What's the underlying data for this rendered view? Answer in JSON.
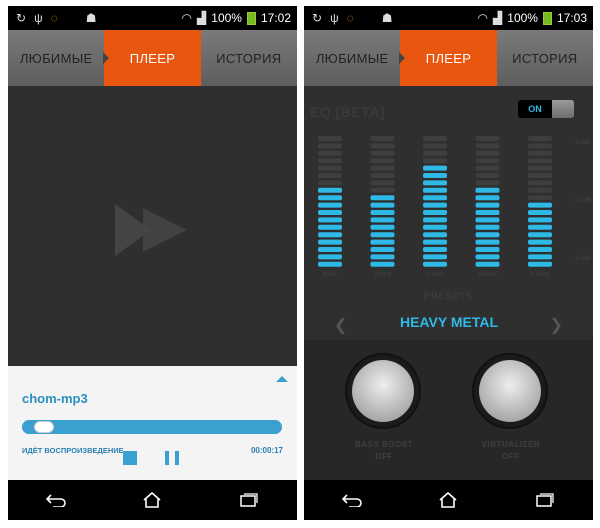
{
  "left_screen": {
    "status_bar": {
      "battery": "100%",
      "time": "17:02"
    },
    "tabs": [
      {
        "label": "ЛЮБИМЫЕ",
        "active": false
      },
      {
        "label": "ПЛЕЕР",
        "active": true
      },
      {
        "label": "ИСТОРИЯ",
        "active": false
      }
    ],
    "player": {
      "track": "chom-mp3",
      "status": "ИДЁТ ВОСПРОИЗВЕДЕНИЕ",
      "elapsed": "00:00:17",
      "progress_fraction": 0.05
    }
  },
  "right_screen": {
    "status_bar": {
      "battery": "100%",
      "time": "17:03"
    },
    "tabs": [
      {
        "label": "ЛЮБИМЫЕ",
        "active": false
      },
      {
        "label": "ПЛЕЕР",
        "active": true
      },
      {
        "label": "ИСТОРИЯ",
        "active": false
      }
    ],
    "eq": {
      "title": "EQ [BETA]",
      "toggle": "ON",
      "bands": [
        {
          "freq": "60Hz",
          "level": 11
        },
        {
          "freq": "230Hz",
          "level": 10
        },
        {
          "freq": "1.1kHz",
          "level": 14
        },
        {
          "freq": "4.6kHz",
          "level": 11
        },
        {
          "freq": "8.6kHz",
          "level": 9
        }
      ],
      "segments_per_band": 18,
      "db_labels": [
        "1.5dB",
        "0.0dB",
        "-1.5dB"
      ],
      "presets_label": "PRESETS",
      "preset": "HEAVY METAL"
    },
    "effects": [
      {
        "label": "BASS BOOST",
        "state": "OFF"
      },
      {
        "label": "VIRTUALIZER",
        "state": "OFF"
      }
    ]
  },
  "colors": {
    "accent_orange": "#e8560f",
    "accent_blue": "#2fb9e6",
    "player_blue": "#3aa0d0"
  }
}
